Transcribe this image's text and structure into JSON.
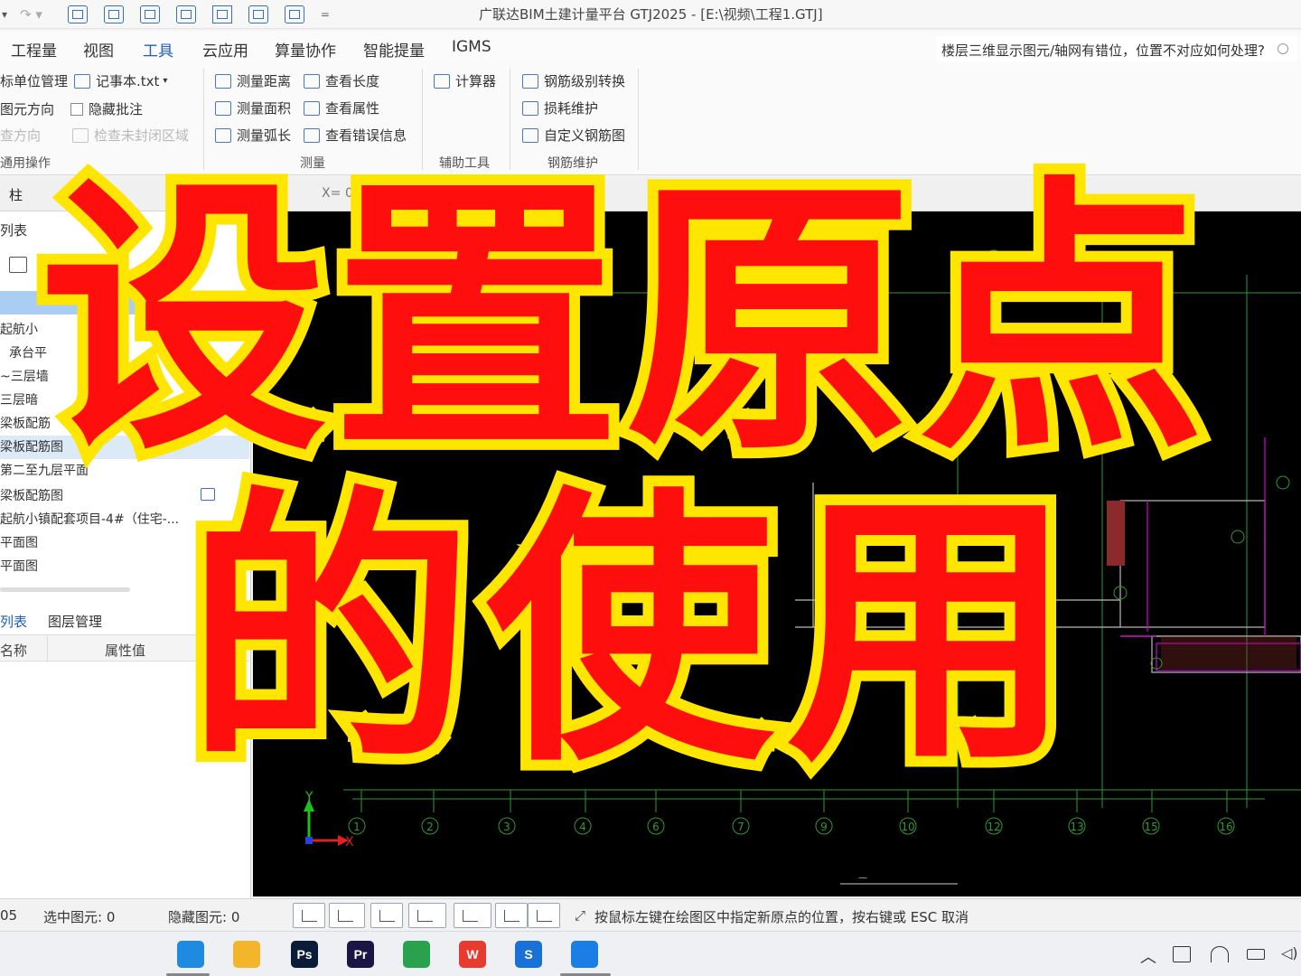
{
  "window": {
    "title": "广联达BIM土建计量平台 GTJ2025 - [E:\\视频\\工程1.GTJ]"
  },
  "menu": {
    "items": [
      {
        "label": "工程量"
      },
      {
        "label": "视图"
      },
      {
        "label": "工具"
      },
      {
        "label": "云应用"
      },
      {
        "label": "算量协作"
      },
      {
        "label": "智能提量"
      },
      {
        "label": "IGMS"
      }
    ],
    "active": "工具"
  },
  "help_search": {
    "text": "楼层三维显示图元/轴网有错位，位置不对应如何处理?"
  },
  "ribbon": {
    "general": {
      "unit_manage": "标单位管理",
      "notepad": "记事本.txt",
      "elem_direction": "图元方向",
      "hide_annotation": "隐藏批注",
      "direction": "查方向",
      "check_closed": "检查未封闭区域",
      "group_label": "通用操作"
    },
    "measure": {
      "distance": "测量距离",
      "area": "测量面积",
      "arc": "测量弧长",
      "view_length": "查看长度",
      "view_attr": "查看属性",
      "view_error": "查看错误信息",
      "group_label": "测量"
    },
    "aux": {
      "calculator": "计算器",
      "group_label": "辅助工具"
    },
    "rebar": {
      "grade_convert": "钢筋级别转换",
      "loss": "损耗维护",
      "custom": "自定义钢筋图",
      "group_label": "钢筋维护"
    }
  },
  "toolrow": {
    "elem": "柱",
    "x_label": "X=",
    "x_value": "0"
  },
  "left_panel": {
    "tab_list": "列表",
    "tree": [
      "起航小",
      "承台平",
      "~三层墙",
      "三层暗",
      "梁板配筋",
      "梁板配筋图",
      "第二至九层平面",
      "梁板配筋图",
      "起航小镇配套项目-4#（住宅-...",
      "平面图",
      "平面图"
    ],
    "props_tab": "列表",
    "layers_tab": "图层管理",
    "col_name": "名称",
    "col_value": "属性值"
  },
  "canvas": {
    "axis_labels_bottom": [
      "1",
      "2",
      "3",
      "4",
      "6",
      "7",
      "9",
      "10",
      "12",
      "13",
      "15",
      "16"
    ],
    "axis_label_top": "12",
    "ucs_x": "X",
    "ucs_y": "Y"
  },
  "status": {
    "left_num": "05",
    "selected": "选中图元: 0",
    "hidden": "隐藏图元: 0",
    "hint": "按鼠标左键在绘图区中指定新原点的位置，按右键或 ESC 取消"
  },
  "taskbar": {
    "apps": [
      {
        "name": "edge",
        "label": "",
        "color": "#1f8be0"
      },
      {
        "name": "explorer",
        "label": "",
        "color": "#f3b62b"
      },
      {
        "name": "photoshop",
        "label": "Ps",
        "color": "#0b1c3a"
      },
      {
        "name": "premiere",
        "label": "Pr",
        "color": "#1b1545"
      },
      {
        "name": "remote",
        "label": "",
        "color": "#2aa14d"
      },
      {
        "name": "wps",
        "label": "W",
        "color": "#e83a2f"
      },
      {
        "name": "sogou",
        "label": "S",
        "color": "#1970d6"
      },
      {
        "name": "gtj",
        "label": "",
        "color": "#1b7ee6"
      }
    ]
  },
  "overlay": {
    "line1": "设置原点",
    "line2": "的使用"
  }
}
